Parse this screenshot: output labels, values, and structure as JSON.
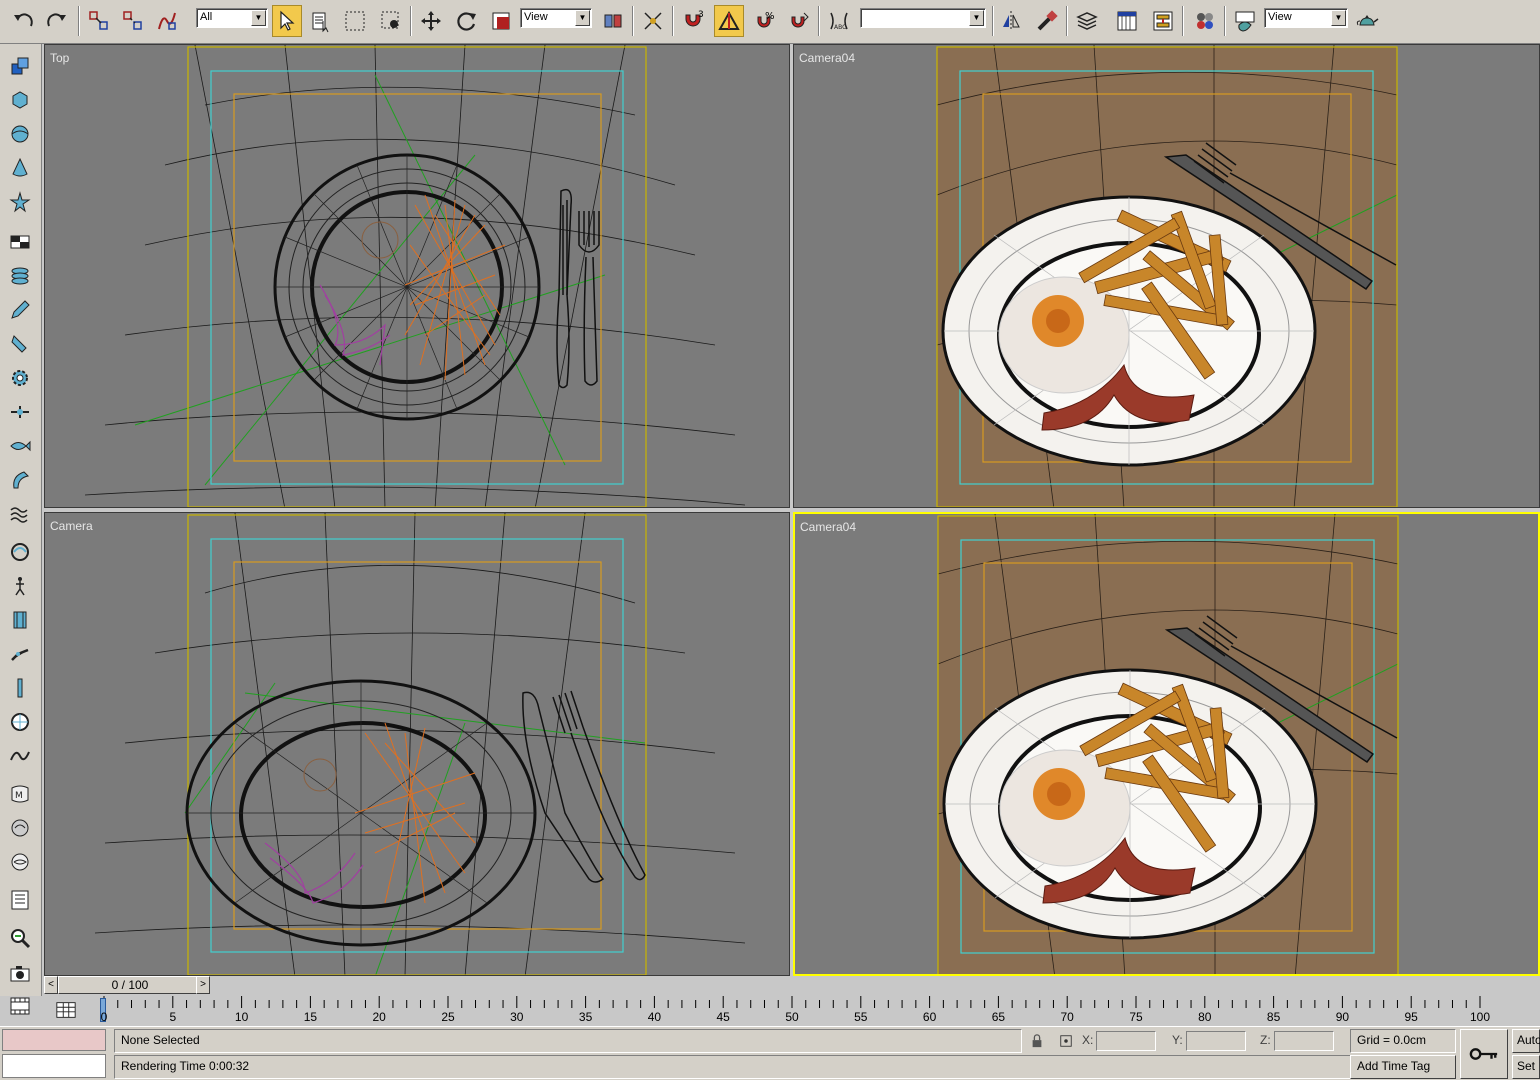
{
  "toolbar": {
    "selection_filter": "All",
    "ref_coord_system": "View",
    "named_selection": "",
    "render_type": "View"
  },
  "viewports": {
    "top_left": {
      "label": "Top"
    },
    "top_right": {
      "label": "Camera04"
    },
    "bottom_left": {
      "label": "Camera"
    },
    "bottom_right": {
      "label": "Camera04"
    }
  },
  "timeslider": {
    "position": "0 / 100",
    "prev": "<",
    "next": ">"
  },
  "trackbar": {
    "ticks": [
      "0",
      "5",
      "10",
      "15",
      "20",
      "25",
      "30",
      "35",
      "40",
      "45",
      "50",
      "55",
      "60",
      "65",
      "70",
      "75",
      "80",
      "85",
      "90",
      "95",
      "100"
    ]
  },
  "status": {
    "selection": "None Selected",
    "prompt": "Rendering Time  0:00:32",
    "x_label": "X:",
    "y_label": "Y:",
    "z_label": "Z:",
    "x_value": "",
    "y_value": "",
    "z_value": "",
    "grid": "Grid = 0.0cm",
    "add_time_tag": "Add Time Tag",
    "auto_key": "Auto",
    "set_key": "Set"
  },
  "colors": {
    "viewport_bg": "#7b7b7b",
    "camera_bg": "#8a6e52",
    "active_border": "#ffff00",
    "safe_frame_outer": "#c8b400",
    "safe_frame_action": "#40d0d0",
    "safe_frame_title": "#d89a20",
    "ui_gray": "#d4d0c8"
  }
}
